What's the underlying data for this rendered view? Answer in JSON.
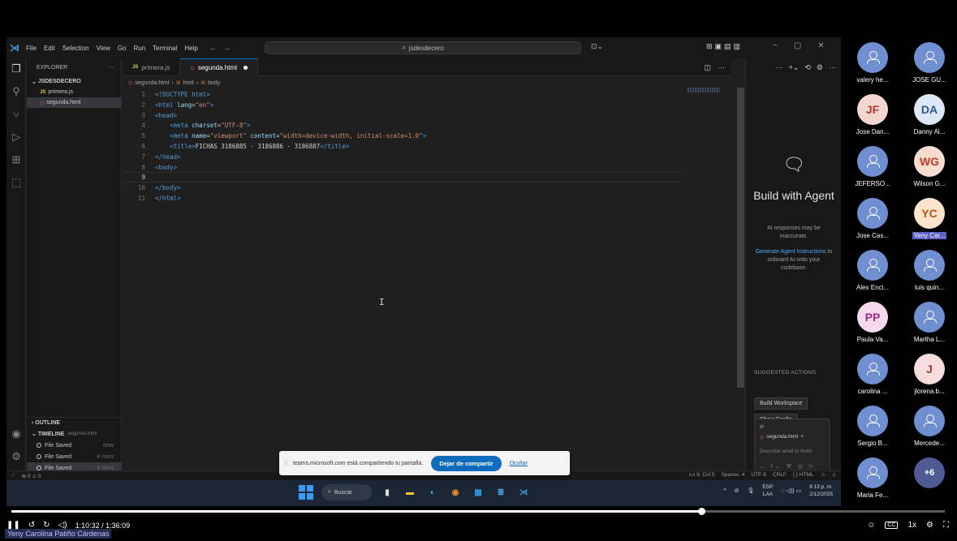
{
  "window": {
    "menu": [
      "File",
      "Edit",
      "Selection",
      "View",
      "Go",
      "Run",
      "Terminal",
      "Help"
    ],
    "search": "jsdesdecero"
  },
  "explorer": {
    "title": "EXPLORER",
    "more": "···",
    "folder": "JSDESDECERO",
    "files": [
      {
        "name": "primera.js",
        "type": "js"
      },
      {
        "name": "segunda.html",
        "type": "html"
      }
    ],
    "outline": "OUTLINE",
    "timeline": "TIMELINE",
    "timeline_file": "segunda.html",
    "timeline_items": [
      {
        "label": "File Saved",
        "when": "now"
      },
      {
        "label": "File Saved",
        "when": "4 mins"
      },
      {
        "label": "File Saved",
        "when": "6 mins"
      }
    ]
  },
  "tabs": [
    {
      "label": "primera.js",
      "type": "js",
      "active": false
    },
    {
      "label": "segunda.html",
      "type": "html",
      "active": true,
      "dirty": true
    }
  ],
  "breadcrumb": [
    "segunda.html",
    "html",
    "body"
  ],
  "code": [
    {
      "n": "1",
      "parts": [
        [
          "t-doct",
          "<!DOCTYPE html>"
        ]
      ]
    },
    {
      "n": "2",
      "parts": [
        [
          "t-tag",
          "<html "
        ],
        [
          "t-attr",
          "lang"
        ],
        [
          "t-txt",
          "="
        ],
        [
          "t-str",
          "\"en\""
        ],
        [
          "t-tag",
          ">"
        ]
      ]
    },
    {
      "n": "3",
      "parts": [
        [
          "t-tag",
          "<head>"
        ]
      ]
    },
    {
      "n": "4",
      "parts": [
        [
          "t-txt",
          "    "
        ],
        [
          "t-tag",
          "<meta "
        ],
        [
          "t-attr",
          "charset"
        ],
        [
          "t-txt",
          "="
        ],
        [
          "t-str",
          "\"UTF-8\""
        ],
        [
          "t-tag",
          ">"
        ]
      ]
    },
    {
      "n": "5",
      "parts": [
        [
          "t-txt",
          "    "
        ],
        [
          "t-tag",
          "<meta "
        ],
        [
          "t-attr",
          "name"
        ],
        [
          "t-txt",
          "="
        ],
        [
          "t-str",
          "\"viewport\" "
        ],
        [
          "t-attr",
          "content"
        ],
        [
          "t-txt",
          "="
        ],
        [
          "t-str",
          "\"width=device-width, initial-scale=1.0\""
        ],
        [
          "t-tag",
          ">"
        ]
      ]
    },
    {
      "n": "6",
      "parts": [
        [
          "t-txt",
          "    "
        ],
        [
          "t-tag",
          "<title>"
        ],
        [
          "t-txt",
          "FICHAS 3186885 - 3186886 - 3186887"
        ],
        [
          "t-tag",
          "</title>"
        ]
      ]
    },
    {
      "n": "7",
      "parts": [
        [
          "t-tag",
          "</head>"
        ]
      ]
    },
    {
      "n": "8",
      "parts": [
        [
          "t-tag",
          "<body>"
        ]
      ]
    },
    {
      "n": "9",
      "parts": [],
      "current": true
    },
    {
      "n": "10",
      "parts": [
        [
          "t-tag",
          "</body>"
        ]
      ]
    },
    {
      "n": "11",
      "parts": [
        [
          "t-tag",
          "</html>"
        ]
      ]
    }
  ],
  "chat": {
    "title": "Build with Agent",
    "note": "AI responses may be inaccurate.",
    "link": "Generate Agent Instructions",
    "link_rest": " to onboard AI onto your codebase.",
    "suggested": "SUGGESTED ACTIONS",
    "actions": [
      "Build Workspace",
      "Show Config"
    ],
    "context_file": "segunda.html",
    "placeholder": "Describe what to build"
  },
  "status": {
    "problems": "⊗ 0 ⚠ 0",
    "position": "Ln 9, Col 5",
    "spaces": "Spaces: 4",
    "encoding": "UTF-8",
    "eol": "CRLF",
    "language": "{ } HTML"
  },
  "share": {
    "text": "teams.microsoft.com está compartiendo tu pantalla.",
    "stop": "Dejar de compartir",
    "hide": "Ocultar"
  },
  "taskbar": {
    "search": "Buscar",
    "lang_top": "ESP",
    "lang_bottom": "LAA",
    "time": "8:13 p. m.",
    "date": "2/12/2025"
  },
  "participants": [
    {
      "name": "valery he...",
      "initials": "",
      "bg": "#6f8fd0"
    },
    {
      "name": "JOSE GU...",
      "initials": "",
      "bg": "#6f8fd0"
    },
    {
      "name": "Jose Dan...",
      "initials": "JF",
      "bg": "#f4d6d0",
      "fg": "#b03a2e"
    },
    {
      "name": "Danny Al...",
      "initials": "DA",
      "bg": "#dde8f7",
      "fg": "#2f5597"
    },
    {
      "name": "JEFERSO...",
      "initials": "",
      "bg": "#6f8fd0"
    },
    {
      "name": "Wilson G...",
      "initials": "WG",
      "bg": "#f7dcd0",
      "fg": "#c0392b"
    },
    {
      "name": "Jose Cas...",
      "initials": "",
      "bg": "#6f8fd0"
    },
    {
      "name": "Yeny Car...",
      "initials": "YC",
      "bg": "#fbe3cc",
      "fg": "#b9520f",
      "highlight": true
    },
    {
      "name": "Alex Enci...",
      "initials": "",
      "bg": "#6f8fd0"
    },
    {
      "name": "luis quin...",
      "initials": "",
      "bg": "#6f8fd0"
    },
    {
      "name": "Paula Va...",
      "initials": "PP",
      "bg": "#f7d9ee",
      "fg": "#9b2f86"
    },
    {
      "name": "Martha L...",
      "initials": "",
      "bg": "#6f8fd0"
    },
    {
      "name": "carolina ...",
      "initials": "",
      "bg": "#6f8fd0"
    },
    {
      "name": "jlorena.b...",
      "initials": "J",
      "bg": "#f7dcdc",
      "fg": "#a23a3a"
    },
    {
      "name": "Sergio B...",
      "initials": "",
      "bg": "#6f8fd0"
    },
    {
      "name": "Mercede...",
      "initials": "",
      "bg": "#6f8fd0"
    },
    {
      "name": "Maria Fe...",
      "initials": "",
      "bg": "#6f8fd0"
    },
    {
      "name": "",
      "initials": "+6",
      "bg": "#4f5a94",
      "fg": "#ffffff",
      "more": true
    }
  ],
  "player": {
    "time": "1:10:32 / 1:36:09",
    "progress": 0.739,
    "speed": "1x",
    "speaker": "Yeny Carolina Patiño Cárdenas"
  }
}
